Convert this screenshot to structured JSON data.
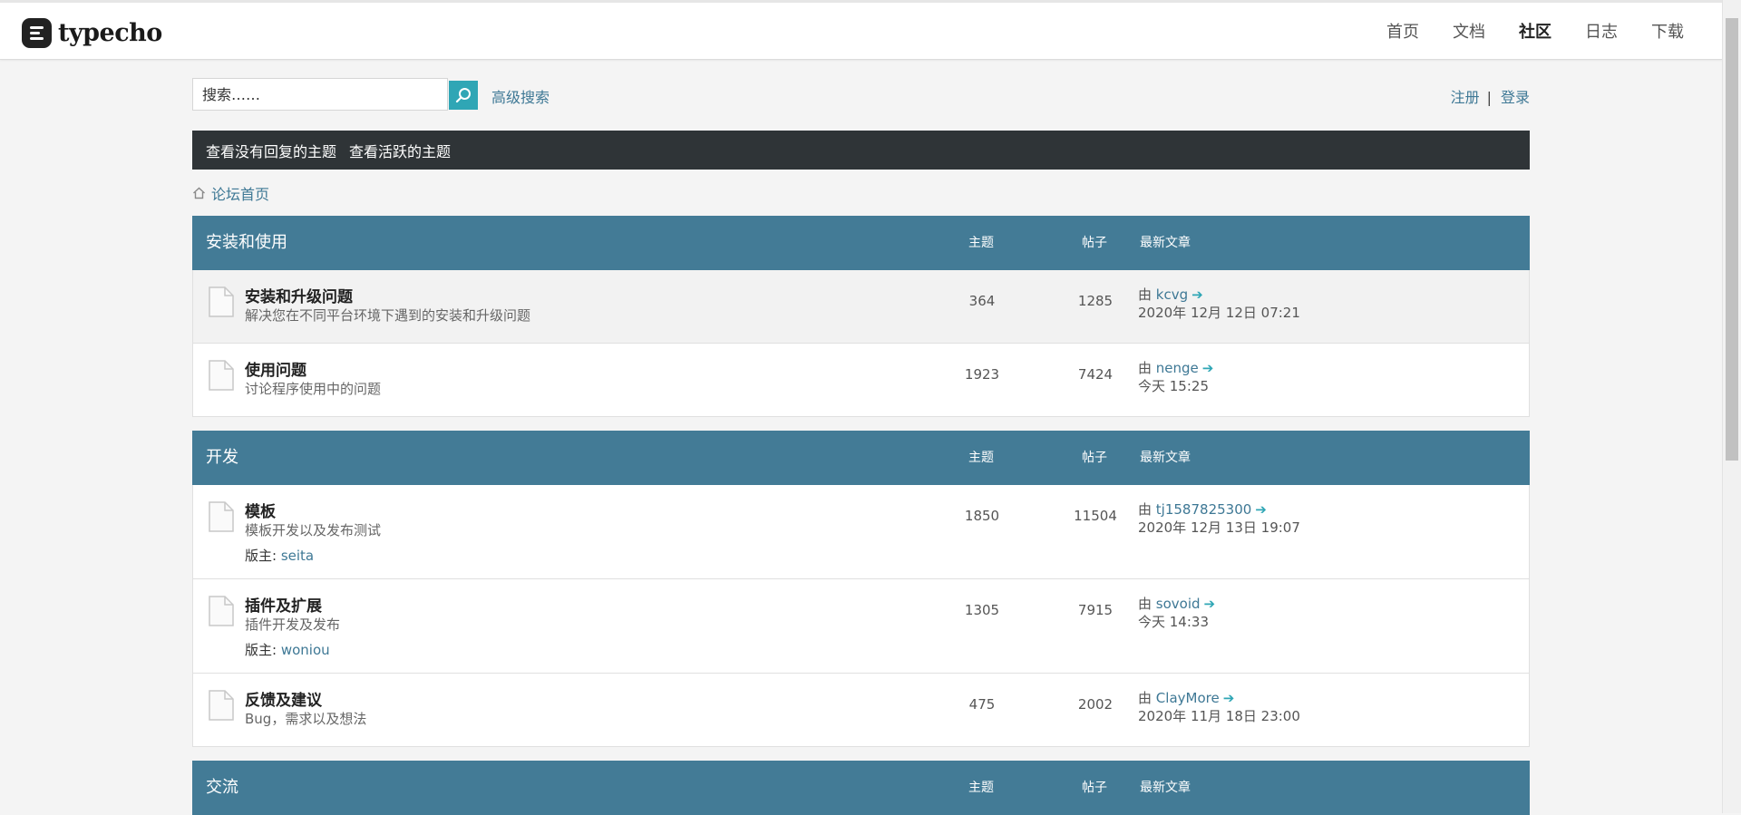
{
  "site": {
    "name": "typecho"
  },
  "nav": [
    "首页",
    "文档",
    "社区",
    "日志",
    "下载"
  ],
  "nav_active": "社区",
  "search": {
    "placeholder": "搜索……",
    "advanced": "高级搜索"
  },
  "auth": {
    "register": "注册",
    "separator": "|",
    "login": "登录"
  },
  "actions": {
    "unanswered": "查看没有回复的主题",
    "active": "查看活跃的主题"
  },
  "breadcrumb": {
    "home": "论坛首页"
  },
  "labels": {
    "topics": "主题",
    "posts": "帖子",
    "latest": "最新文章",
    "by": "由",
    "moderator": "版主:"
  },
  "sections": [
    {
      "title": "安装和使用",
      "forums": [
        {
          "title": "安装和升级问题",
          "desc": "解决您在不同平台环境下遇到的安装和升级问题",
          "topics": "364",
          "posts": "1285",
          "author": "kcvg",
          "time": "2020年 12月 12日 07:21"
        },
        {
          "title": "使用问题",
          "desc": "讨论程序使用中的问题",
          "topics": "1923",
          "posts": "7424",
          "author": "nenge",
          "time": "今天 15:25"
        }
      ]
    },
    {
      "title": "开发",
      "forums": [
        {
          "title": "模板",
          "desc": "模板开发以及发布测试",
          "moderator": "seita",
          "topics": "1850",
          "posts": "11504",
          "author": "tj1587825300",
          "time": "2020年 12月 13日 19:07"
        },
        {
          "title": "插件及扩展",
          "desc": "插件开发及发布",
          "moderator": "woniou",
          "topics": "1305",
          "posts": "7915",
          "author": "sovoid",
          "time": "今天 14:33"
        },
        {
          "title": "反馈及建议",
          "desc": "Bug，需求以及想法",
          "topics": "475",
          "posts": "2002",
          "author": "ClayMore",
          "time": "2020年 11月 18日 23:00"
        }
      ]
    },
    {
      "title": "交流",
      "forums": []
    }
  ],
  "colors": {
    "header_blue": "#437b96",
    "action_bar": "#2f3437",
    "search_button": "#2fa6b5",
    "link": "#3e7895"
  }
}
